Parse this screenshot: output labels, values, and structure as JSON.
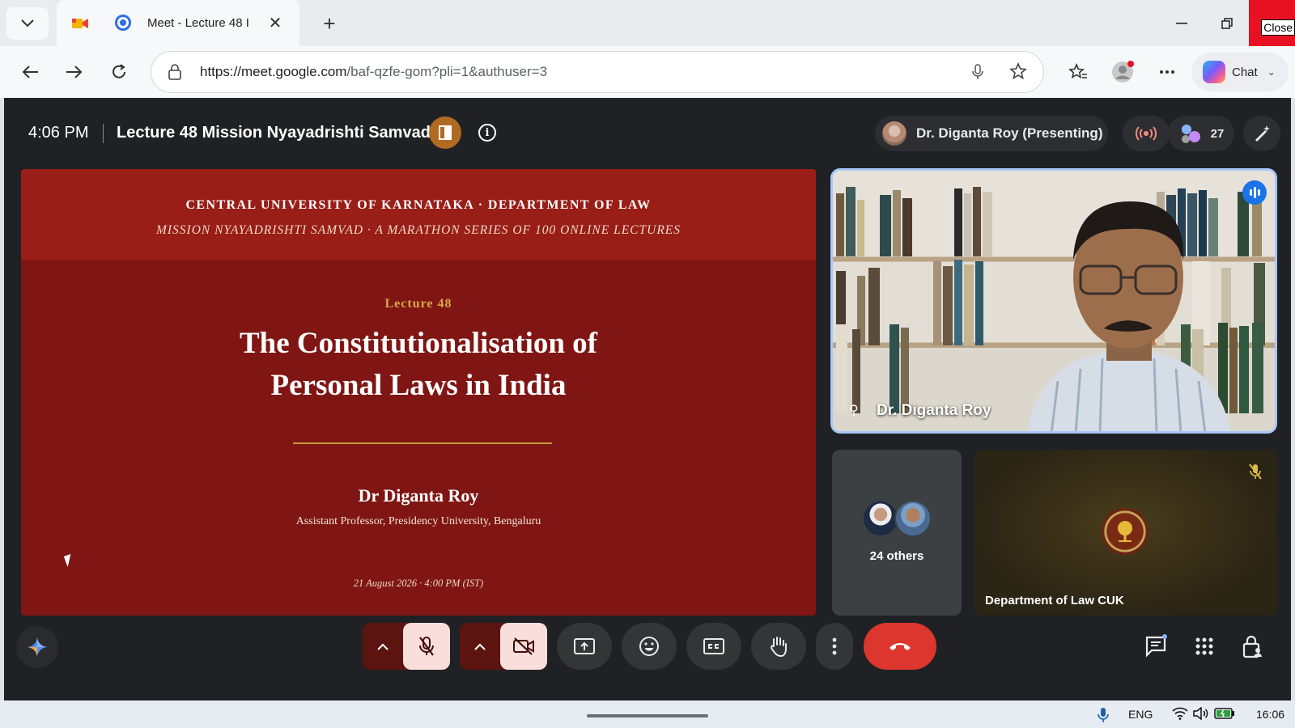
{
  "browser": {
    "tab_title": "Meet - Lecture 48 I",
    "close_tooltip": "Close",
    "url_host": "https://meet.google.com",
    "url_path": "/baf-qzfe-gom?pli=1&authuser=3",
    "chat_label": "Chat"
  },
  "meet": {
    "clock": "4:06 PM",
    "meeting_title": "Lecture 48 Mission Nyayadrishti Samvad",
    "presenting_label": "Dr. Diganta Roy (Presenting)",
    "participant_count": "27",
    "speaker_name": "Dr. Diganta Roy",
    "others_label": "24 others",
    "dept_tile_name": "Department of Law CUK"
  },
  "slide": {
    "header_line1": "CENTRAL UNIVERSITY OF KARNATAKA · DEPARTMENT OF LAW",
    "header_line2": "MISSION NYAYADRISHTI SAMVAD  ·  A MARATHON SERIES OF 100 ONLINE LECTURES",
    "lecture_no": "Lecture 48",
    "title": "The Constitutionalisation of Personal Laws in India",
    "speaker": "Dr Diganta Roy",
    "affiliation": "Assistant Professor, Presidency University, Bengaluru",
    "date": "21 August 2026  ·  4:00 PM (IST)"
  },
  "taskbar": {
    "language": "ENG",
    "time": "16:06"
  },
  "colors": {
    "meet_bg": "#202124",
    "slide_bg": "#7f1613",
    "slide_header": "#981e17",
    "accent_gold": "#d9a74a",
    "end_call": "#dc362e",
    "active_speaker_border": "#a8c7fa"
  }
}
